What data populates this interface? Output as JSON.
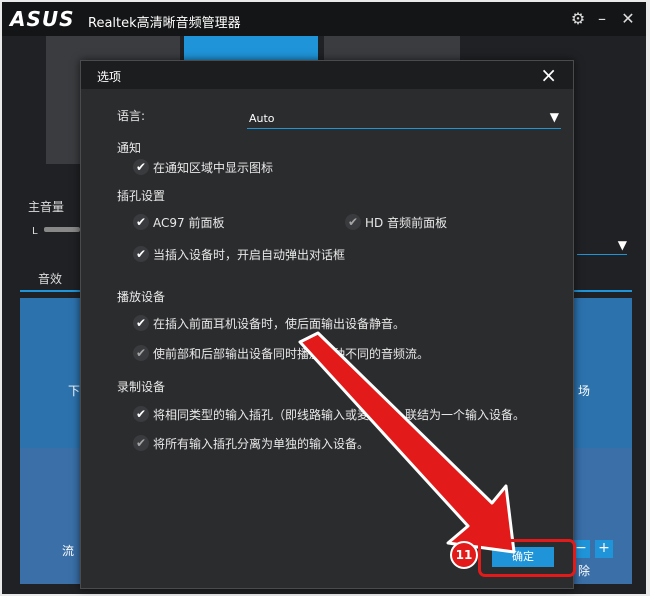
{
  "window": {
    "logo": "ASUS",
    "title": "Realtek高清晰音频管理器"
  },
  "background": {
    "main_volume_label": "主音量",
    "l_label": "L",
    "sound_tab": "音效",
    "left_text_1": "下",
    "left_text_2": "流",
    "right_text_1": "场",
    "right_text_2": "除"
  },
  "dialog": {
    "title": "选项",
    "language_label": "语言:",
    "language_value": "Auto",
    "notify_section": "通知",
    "notify_show_icon": "在通知区域中显示图标",
    "jack_section": "插孔设置",
    "ac97_front": "AC97 前面板",
    "hd_front": "HD 音频前面板",
    "auto_popup": "当插入设备时，开启自动弹出对话框",
    "playback_section": "播放设备",
    "mute_rear": "在插入前面耳机设备时，使后面输出设备静音。",
    "two_streams": "使前部和后部输出设备同时播放两种不同的音频流。",
    "record_section": "录制设备",
    "combine_inputs": "将相同类型的输入插孔（即线路输入或麦克风）联结为一个输入设备。",
    "separate_inputs": "将所有输入插孔分离为单独的输入设备。",
    "ok_label": "确定"
  },
  "annotation": {
    "step_number": "11",
    "highlight_color": "#e21a1a"
  },
  "colors": {
    "accent": "#1f94d8"
  }
}
